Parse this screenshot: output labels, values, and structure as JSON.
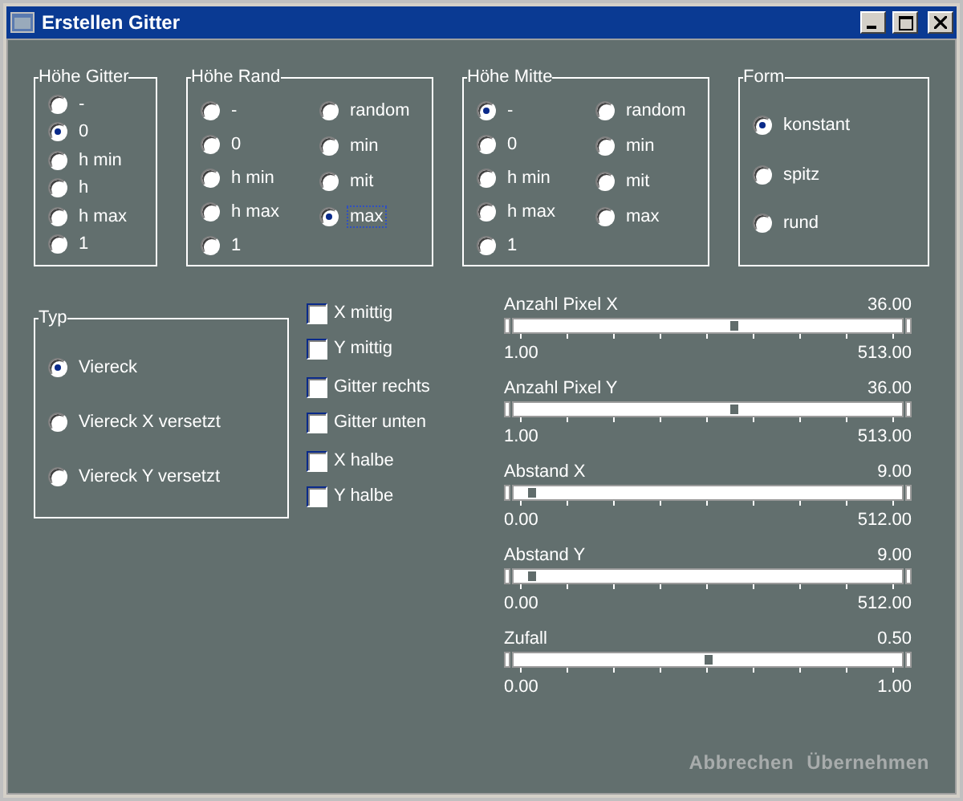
{
  "window": {
    "title": "Erstellen Gitter"
  },
  "radio_groups": [
    {
      "title": "Höhe Gitter",
      "columns": [
        [
          {
            "label": "-",
            "selected": false,
            "focused": false
          },
          {
            "label": "0",
            "selected": true,
            "focused": false
          },
          {
            "label": "h min",
            "selected": false,
            "focused": false
          },
          {
            "label": "h",
            "selected": false,
            "focused": false
          },
          {
            "label": "h max",
            "selected": false,
            "focused": false
          },
          {
            "label": "1",
            "selected": false,
            "focused": false
          }
        ]
      ]
    },
    {
      "title": "Höhe Rand",
      "columns": [
        [
          {
            "label": "-",
            "selected": false,
            "focused": false
          },
          {
            "label": "0",
            "selected": false,
            "focused": false
          },
          {
            "label": "h min",
            "selected": false,
            "focused": false
          },
          {
            "label": "h max",
            "selected": false,
            "focused": false
          },
          {
            "label": "1",
            "selected": false,
            "focused": false
          }
        ],
        [
          {
            "label": "random",
            "selected": false,
            "focused": false
          },
          {
            "label": "min",
            "selected": false,
            "focused": false
          },
          {
            "label": "mit",
            "selected": false,
            "focused": false
          },
          {
            "label": "max",
            "selected": true,
            "focused": true
          }
        ]
      ]
    },
    {
      "title": "Höhe Mitte",
      "columns": [
        [
          {
            "label": "-",
            "selected": true,
            "focused": false
          },
          {
            "label": "0",
            "selected": false,
            "focused": false
          },
          {
            "label": "h min",
            "selected": false,
            "focused": false
          },
          {
            "label": "h max",
            "selected": false,
            "focused": false
          },
          {
            "label": "1",
            "selected": false,
            "focused": false
          }
        ],
        [
          {
            "label": "random",
            "selected": false,
            "focused": false
          },
          {
            "label": "min",
            "selected": false,
            "focused": false
          },
          {
            "label": "mit",
            "selected": false,
            "focused": false
          },
          {
            "label": "max",
            "selected": false,
            "focused": false
          }
        ]
      ]
    },
    {
      "title": "Form",
      "columns": [
        [
          {
            "label": "konstant",
            "selected": true,
            "focused": false
          },
          {
            "label": "spitz",
            "selected": false,
            "focused": false
          },
          {
            "label": "rund",
            "selected": false,
            "focused": false
          }
        ]
      ]
    }
  ],
  "type_group": {
    "title": "Typ",
    "options": [
      {
        "label": "Viereck",
        "selected": true
      },
      {
        "label": "Viereck X versetzt",
        "selected": false
      },
      {
        "label": "Viereck Y versetzt",
        "selected": false
      }
    ]
  },
  "checkbox_groups": [
    [
      {
        "label": "X mittig",
        "checked": false
      },
      {
        "label": "Y mittig",
        "checked": false
      }
    ],
    [
      {
        "label": "Gitter rechts",
        "checked": false
      },
      {
        "label": "Gitter unten",
        "checked": false
      }
    ],
    [
      {
        "label": "X halbe",
        "checked": false
      },
      {
        "label": "Y halbe",
        "checked": false
      }
    ]
  ],
  "sliders": [
    {
      "label": "Anzahl Pixel X",
      "reading": "36.00",
      "min": "1.00",
      "max": "513.00",
      "level": 0.57
    },
    {
      "label": "Anzahl Pixel Y",
      "reading": "36.00",
      "min": "1.00",
      "max": "513.00",
      "level": 0.57
    },
    {
      "label": "Abstand X",
      "reading": "9.00",
      "min": "0.00",
      "max": "512.00",
      "level": 0.04
    },
    {
      "label": "Abstand Y",
      "reading": "9.00",
      "min": "0.00",
      "max": "512.00",
      "level": 0.04
    },
    {
      "label": "Zufall",
      "reading": "0.50",
      "min": "0.00",
      "max": "1.00",
      "level": 0.5
    }
  ],
  "buttons": [
    {
      "label": "Abbrechen",
      "disabled": true
    },
    {
      "label": "Übernehmen",
      "disabled": true
    }
  ]
}
